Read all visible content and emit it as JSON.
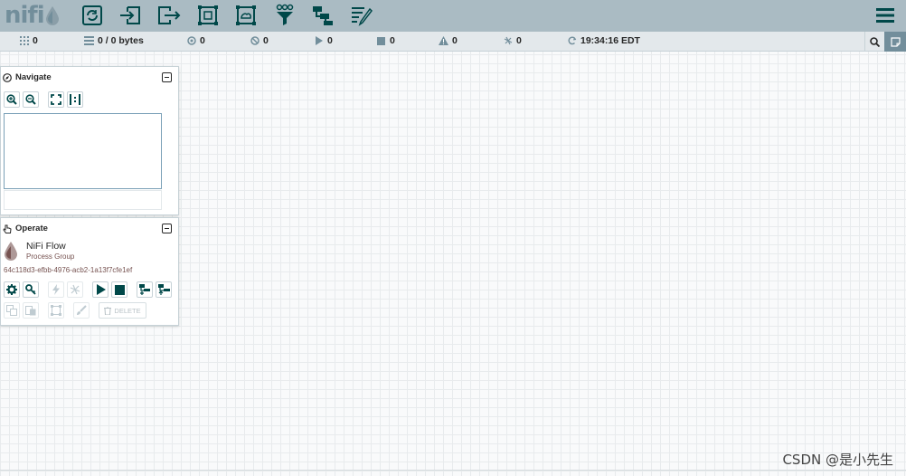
{
  "header": {
    "logo_text": "nifi",
    "tools": [
      {
        "name": "processor",
        "icon": "processor-icon"
      },
      {
        "name": "input-port",
        "icon": "input-port-icon"
      },
      {
        "name": "output-port",
        "icon": "output-port-icon"
      },
      {
        "name": "process-group",
        "icon": "process-group-icon"
      },
      {
        "name": "remote-process-group",
        "icon": "remote-process-group-icon"
      },
      {
        "name": "funnel",
        "icon": "funnel-icon"
      },
      {
        "name": "template",
        "icon": "template-icon"
      },
      {
        "name": "label",
        "icon": "label-icon"
      }
    ],
    "menu_icon": "hamburger-icon"
  },
  "status": {
    "active_threads": "0",
    "queued": "0 / 0 bytes",
    "transmitting": "0",
    "not_transmitting": "0",
    "running": "0",
    "stopped": "0",
    "invalid": "0",
    "disabled": "0",
    "last_refreshed": "19:34:16 EDT"
  },
  "navigate": {
    "title": "Navigate"
  },
  "operate": {
    "title": "Operate",
    "name": "NiFi Flow",
    "type": "Process Group",
    "id": "64c118d3-efbb-4976-acb2-1a13f7cfe1ef",
    "delete_label": "DELETE"
  },
  "watermark": "CSDN @是小先生",
  "colors": {
    "header_bg": "#aabbc3",
    "icon_dark": "#004849",
    "status_bg": "#e3e8eb",
    "accent": "#728e9b"
  }
}
